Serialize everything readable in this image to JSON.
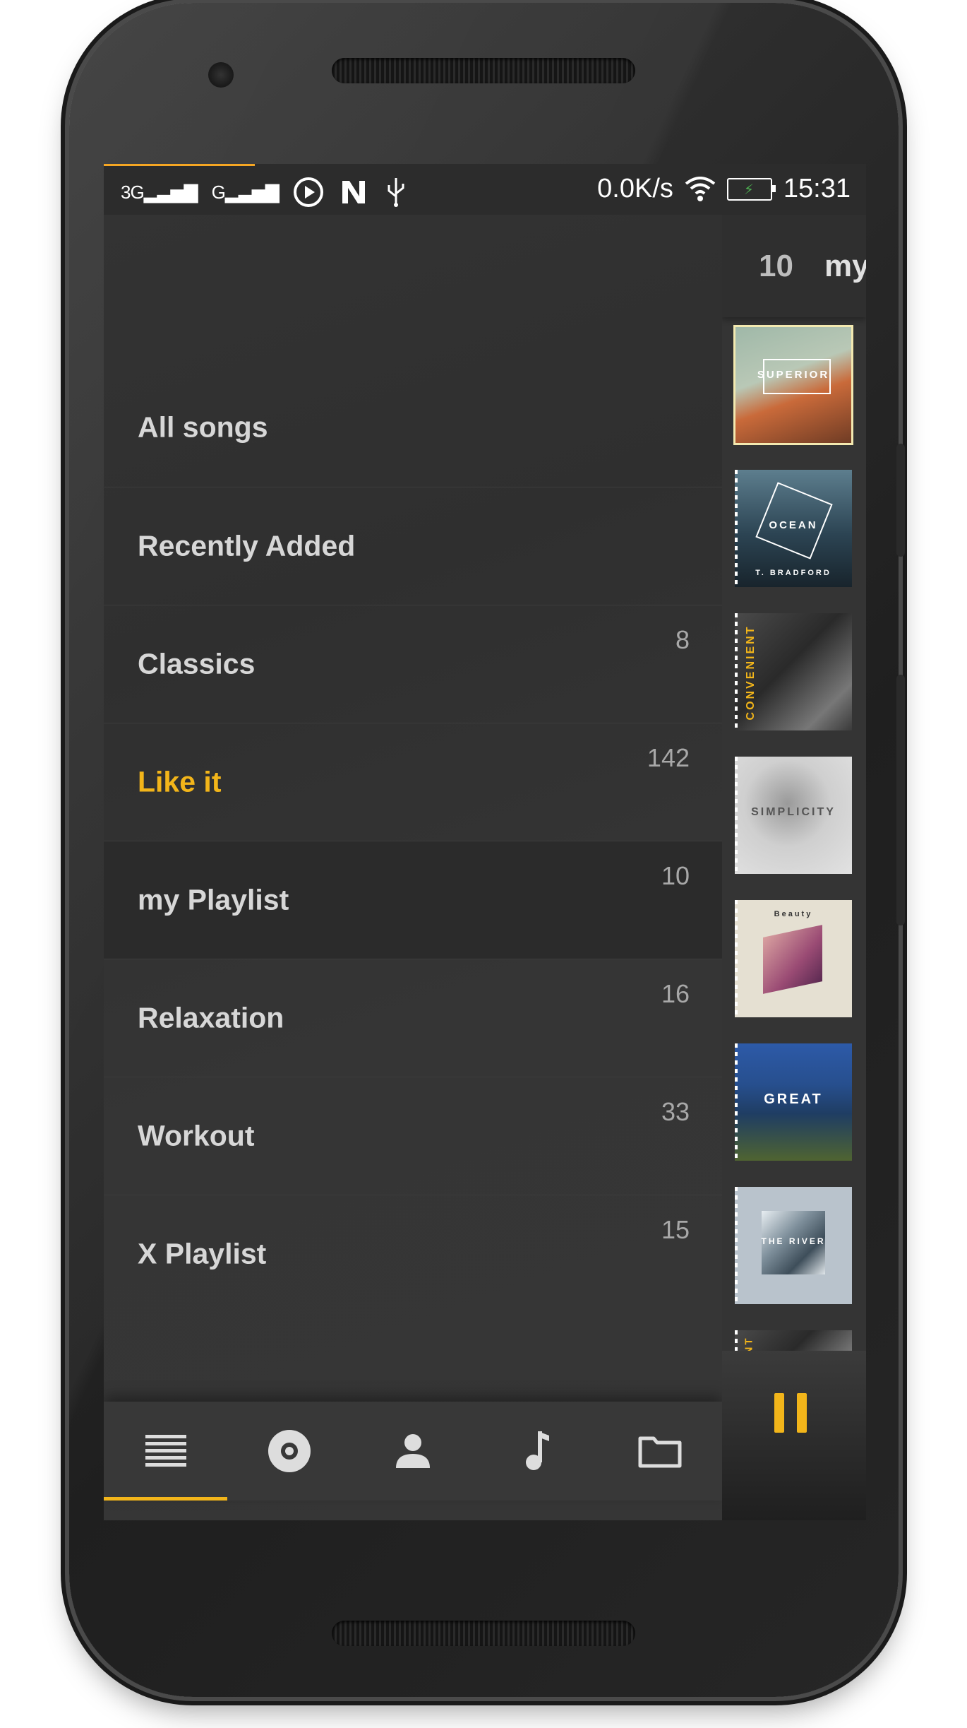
{
  "status_bar": {
    "network_1": "3G",
    "network_2": "G",
    "net_speed": "0.0K/s",
    "time": "15:31",
    "icons": [
      "signal-icon",
      "signal-icon",
      "player-icon",
      "n-icon",
      "usb-icon",
      "wifi-icon",
      "battery-charging-icon"
    ]
  },
  "drawer": {
    "items": [
      {
        "label": "All songs",
        "count": "",
        "active": false,
        "selected": false
      },
      {
        "label": "Recently Added",
        "count": "",
        "active": false,
        "selected": false
      },
      {
        "label": "Classics",
        "count": "8",
        "active": false,
        "selected": false
      },
      {
        "label": "Like it",
        "count": "142",
        "active": true,
        "selected": false
      },
      {
        "label": "my Playlist",
        "count": "10",
        "active": false,
        "selected": true
      },
      {
        "label": "Relaxation",
        "count": "16",
        "active": false,
        "selected": false
      },
      {
        "label": "Workout",
        "count": "33",
        "active": false,
        "selected": false
      },
      {
        "label": "X Playlist",
        "count": "15",
        "active": false,
        "selected": false
      }
    ],
    "bottom_nav": [
      "playlists-icon",
      "album-icon",
      "artist-icon",
      "songs-icon",
      "folder-icon"
    ]
  },
  "main": {
    "count": "10",
    "title": "my",
    "albums": [
      {
        "name": "album-superior",
        "text": "SUPERIOR"
      },
      {
        "name": "album-ocean",
        "text": "OCEAN",
        "sub": "T. BRADFORD"
      },
      {
        "name": "album-convenient",
        "text": "CONVENIENT"
      },
      {
        "name": "album-simplicity",
        "text": "SIMPLICITY"
      },
      {
        "name": "album-beauty",
        "text": "Beauty"
      },
      {
        "name": "album-great",
        "text": "GREAT"
      },
      {
        "name": "album-the-river",
        "text": "THE RIVER"
      },
      {
        "name": "album-convenient-2",
        "text": "NIENT"
      }
    ]
  },
  "colors": {
    "accent": "#f2b51a",
    "drawer_bg": "#333333",
    "selected_row": "#2b2b2b"
  }
}
